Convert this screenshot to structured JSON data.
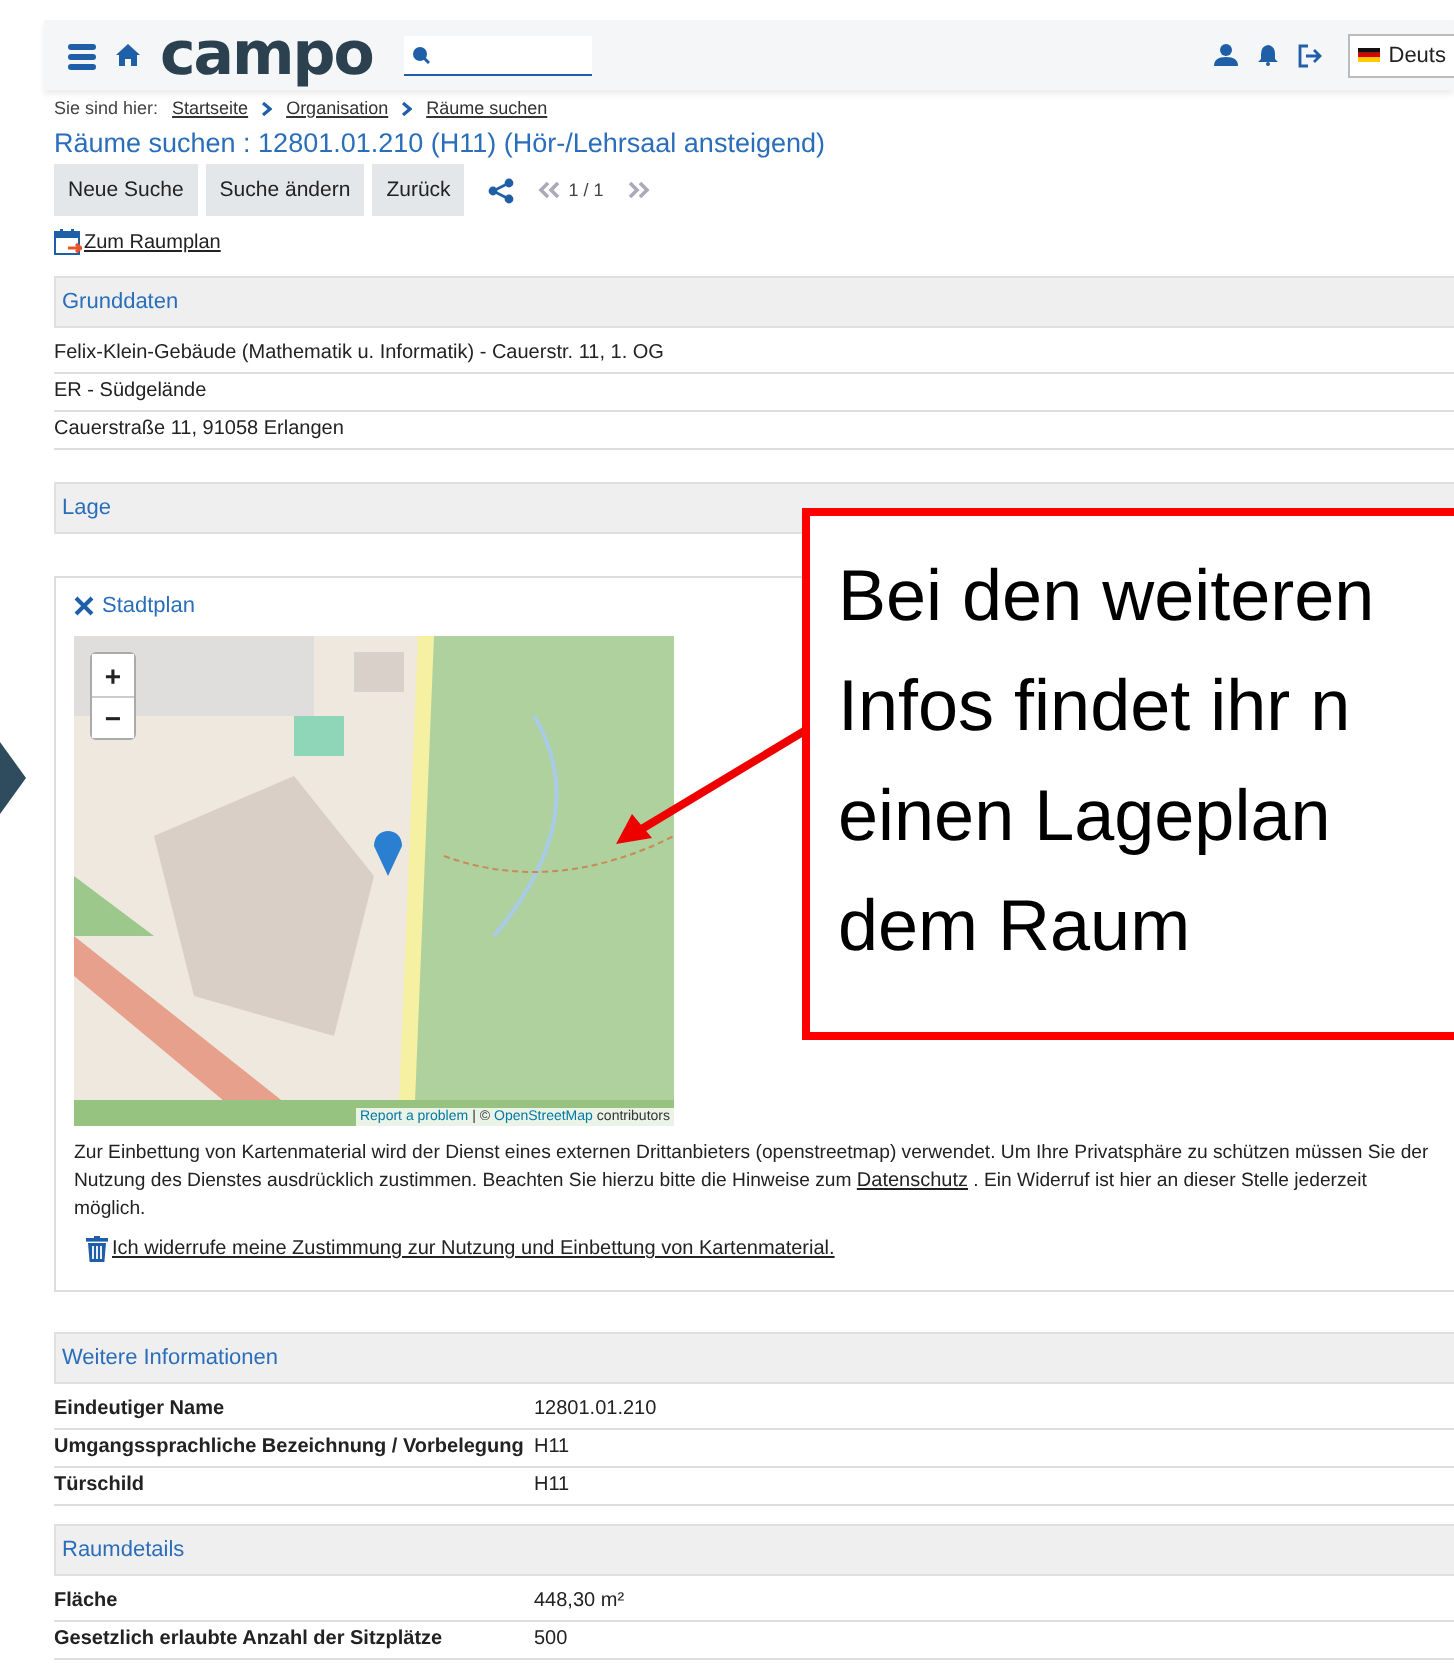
{
  "header": {
    "logo": "campo",
    "language": "Deuts"
  },
  "breadcrumb": {
    "label": "Sie sind hier:",
    "items": [
      "Startseite",
      "Organisation",
      "Räume suchen"
    ]
  },
  "title": "Räume suchen : 12801.01.210 (H11) (Hör-/Lehrsaal ansteigend)",
  "buttons": [
    "Neue Suche",
    "Suche ändern",
    "Zurück"
  ],
  "pager": "1 / 1",
  "raumplan_link": "Zum Raumplan",
  "grunddaten": {
    "heading": "Grunddaten",
    "lines": [
      "Felix-Klein-Gebäude (Mathematik u. Informatik) - Cauerstr. 11, 1. OG",
      "ER - Südgelände",
      "Cauerstraße 11, 91058 Erlangen"
    ]
  },
  "lage": {
    "heading": "Lage",
    "stadtplan": {
      "title": "Stadtplan",
      "map": {
        "zoom_in": "+",
        "zoom_out": "−",
        "report_link": "Report a problem",
        "separator": "| ©",
        "osm_link": "OpenStreetMap",
        "contributors": "contributors"
      },
      "notice_start": "Zur Einbettung von Kartenmaterial wird der Dienst eines externen Drittanbieters (openstreetmap) verwendet. Um Ihre Privatsphäre zu schützen müssen Sie der Nutzung des Dienstes ausdrücklich zustimmen. Beachten Sie hierzu bitte die Hinweise zum",
      "privacy_link": "Datenschutz",
      "notice_end": ". Ein Widerruf ist hier an dieser Stelle jederzeit möglich.",
      "revoke_link": "Ich widerrufe meine Zustimmung zur Nutzung und Einbettung von Kartenmaterial."
    }
  },
  "weitere": {
    "heading": "Weitere Informationen",
    "rows": [
      {
        "label": "Eindeutiger Name",
        "value": "12801.01.210"
      },
      {
        "label": "Umgangssprachliche Bezeichnung / Vorbelegung",
        "value": "H11"
      },
      {
        "label": "Türschild",
        "value": "H11"
      }
    ]
  },
  "raumdetails": {
    "heading": "Raumdetails",
    "rows": [
      {
        "label": "Fläche",
        "value": "448,30 m²"
      },
      {
        "label": "Gesetzlich erlaubte Anzahl der Sitzplätze",
        "value": "500"
      }
    ]
  },
  "callout": {
    "lines": [
      "Bei den weiteren",
      "Infos findet ihr n",
      "einen Lageplan",
      "dem Raum"
    ]
  }
}
